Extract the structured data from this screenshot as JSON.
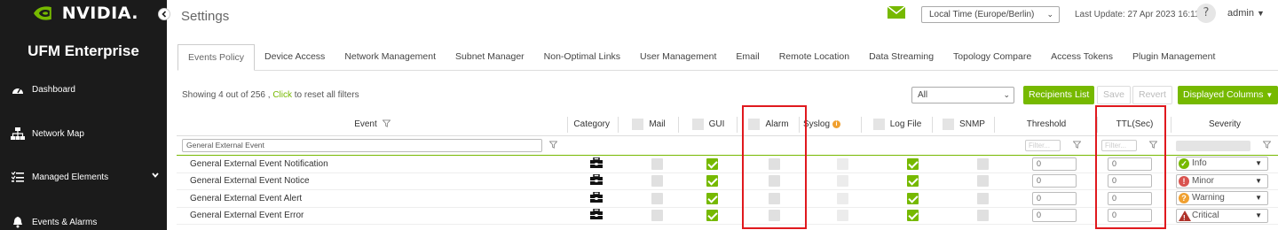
{
  "brand": {
    "logo_text": "NVIDIA.",
    "product": "UFM Enterprise"
  },
  "sidebar": {
    "items": [
      {
        "label": "Dashboard",
        "icon": "dashboard-icon"
      },
      {
        "label": "Network Map",
        "icon": "network-map-icon"
      },
      {
        "label": "Managed Elements",
        "icon": "list-icon",
        "expandable": true
      },
      {
        "label": "Events & Alarms",
        "icon": "bell-icon"
      }
    ]
  },
  "header": {
    "title": "Settings",
    "timezone": "Local Time (Europe/Berlin)",
    "last_update": "Last Update: 27 Apr 2023 16:11",
    "help": "?",
    "user": "admin"
  },
  "tabs": [
    {
      "label": "Events Policy",
      "active": true
    },
    {
      "label": "Device Access"
    },
    {
      "label": "Network Management"
    },
    {
      "label": "Subnet Manager"
    },
    {
      "label": "Non-Optimal Links"
    },
    {
      "label": "User Management"
    },
    {
      "label": "Email"
    },
    {
      "label": "Remote Location"
    },
    {
      "label": "Data Streaming"
    },
    {
      "label": "Topology Compare"
    },
    {
      "label": "Access Tokens"
    },
    {
      "label": "Plugin Management"
    }
  ],
  "toolbar": {
    "showing_prefix": "Showing 4 out of 256 ,",
    "click_link": "Click",
    "showing_suffix": "to reset all filters",
    "filter_select": "All",
    "recipients_btn": "Recipients List",
    "save_btn": "Save",
    "revert_btn": "Revert",
    "columns_btn": "Displayed Columns"
  },
  "table": {
    "headers": {
      "event": "Event",
      "category": "Category",
      "mail": "Mail",
      "gui": "GUI",
      "alarm": "Alarm",
      "syslog": "Syslog",
      "logfile": "Log File",
      "snmp": "SNMP",
      "threshold": "Threshold",
      "ttl": "TTL(Sec)",
      "severity": "Severity"
    },
    "filters": {
      "event": "General External Event",
      "threshold_placeholder": "Filter...",
      "ttl_placeholder": "Filter..."
    },
    "rows": [
      {
        "event": "General External Event Notification",
        "threshold": "0",
        "ttl": "0",
        "severity": "Info",
        "sev_color": "#76b900"
      },
      {
        "event": "General External Event Notice",
        "threshold": "0",
        "ttl": "0",
        "severity": "Minor",
        "sev_color": "#d9534f"
      },
      {
        "event": "General External Event Alert",
        "threshold": "0",
        "ttl": "0",
        "severity": "Warning",
        "sev_color": "#f0a030"
      },
      {
        "event": "General External Event Error",
        "threshold": "0",
        "ttl": "0",
        "severity": "Critical",
        "sev_color": "#b0322a"
      }
    ]
  },
  "colors": {
    "accent": "#76b900",
    "sidebar": "#1b1b1b",
    "highlight": "#e0191e"
  }
}
